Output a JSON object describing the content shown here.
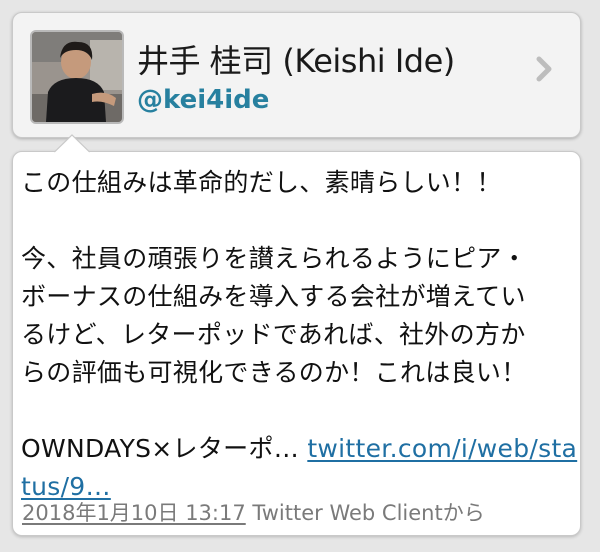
{
  "profile": {
    "display_name": "井手 桂司 (Keishi Ide)",
    "handle": "@kei4ide",
    "avatar_icon": "person-photo-icon",
    "chevron_icon": "chevron-right-icon"
  },
  "tweet": {
    "line1": "この仕組みは革命的だし、素晴らしい！！",
    "line2": "今、社員の頑張りを讃えられるようにピア・",
    "line3": "ボーナスの仕組みを導入する会社が増えてい",
    "line4": "るけど、レターポッドであれば、社外の方か",
    "line5": "らの評価も可視化できるのか！これは良い！",
    "link_prefix": "OWNDAYS×レターポ… ",
    "link_text_1": "twitter.com/i/web/sta",
    "link_text_2": "tus/9…"
  },
  "meta": {
    "timestamp": "2018年1月10日 13:17",
    "client": " Twitter Web Clientから"
  },
  "colors": {
    "handle": "#27809f",
    "link": "#1f6fa3",
    "meta": "#7a7a7a",
    "background": "#e6e6e6"
  }
}
